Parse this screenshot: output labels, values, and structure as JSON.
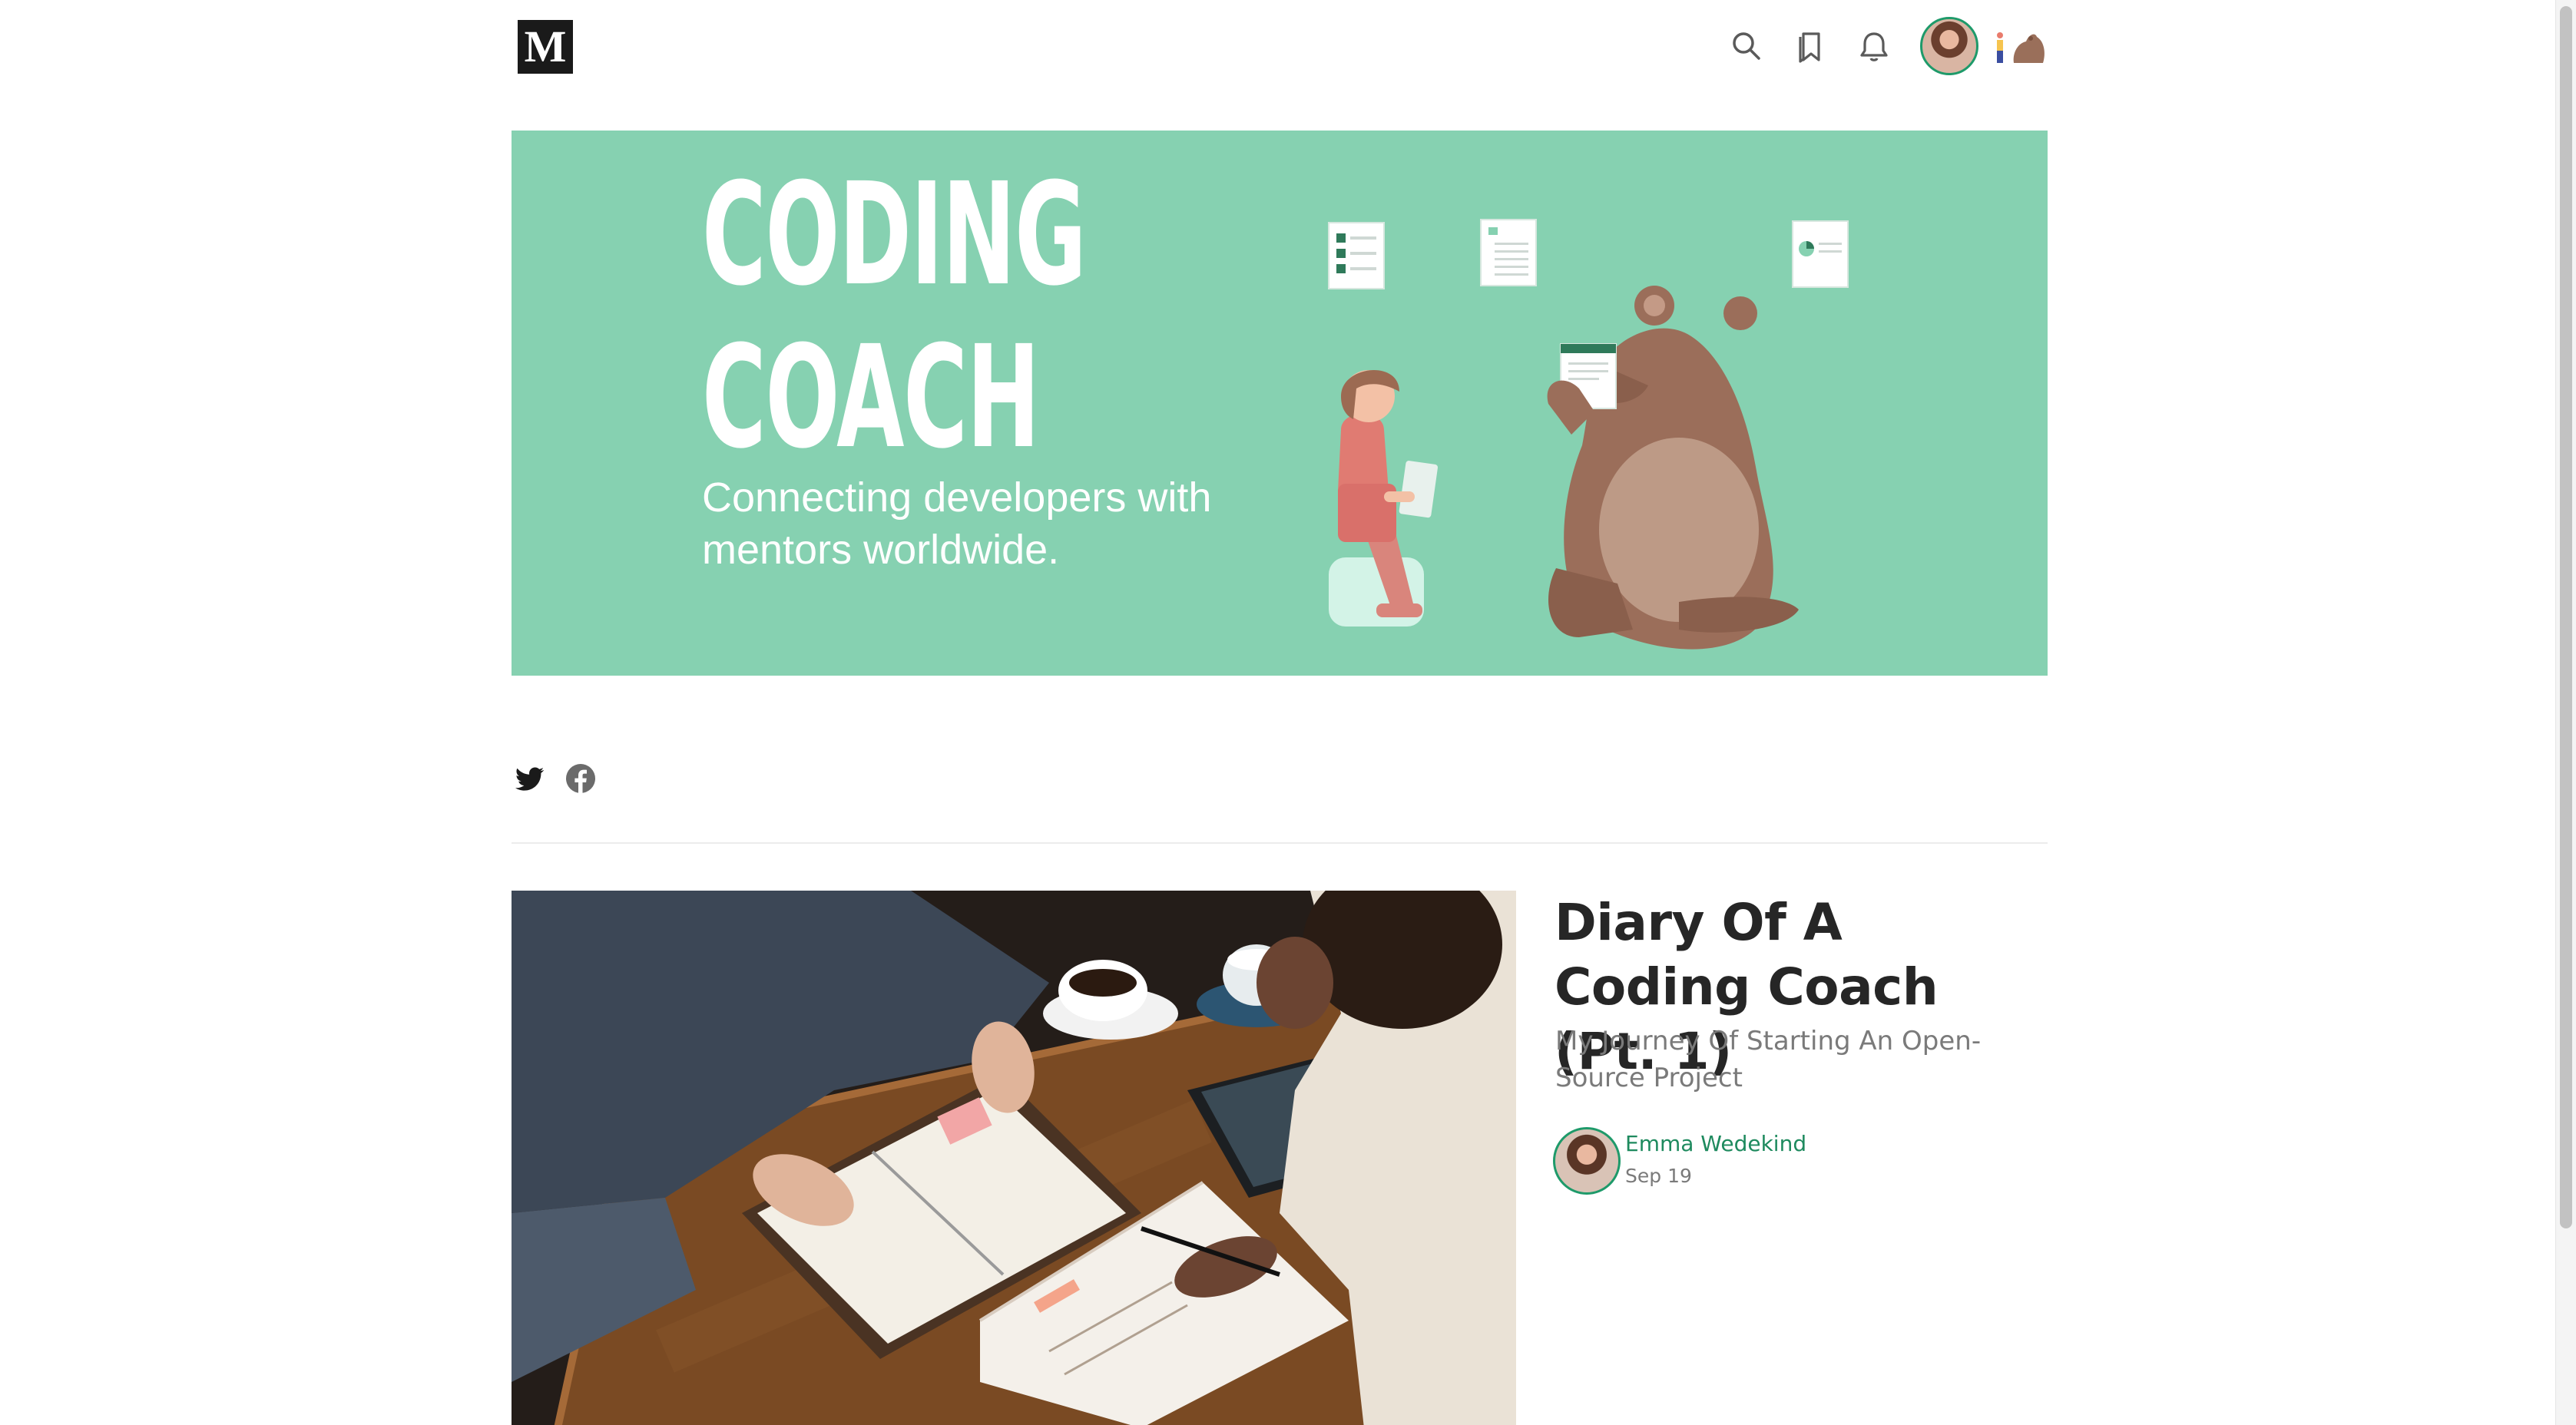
{
  "header": {
    "logo_text": "M",
    "icons": [
      "search-icon",
      "bookmarks-icon",
      "notifications-icon"
    ],
    "accent_color": "#1e9a6a"
  },
  "banner": {
    "title_line1": "CODING",
    "title_line2": "COACH",
    "tagline_line1": "Connecting developers with",
    "tagline_line2": "mentors worldwide.",
    "background_color": "#86d1b1"
  },
  "social": {
    "icons": [
      "twitter-icon",
      "facebook-icon"
    ]
  },
  "post": {
    "title": "Diary Of A Coding Coach (Pt. 1)",
    "subtitle": "My Journey Of Starting An Open-Source Project",
    "author": "Emma Wedekind",
    "date": "Sep 19",
    "author_color": "#1e8a5e"
  }
}
